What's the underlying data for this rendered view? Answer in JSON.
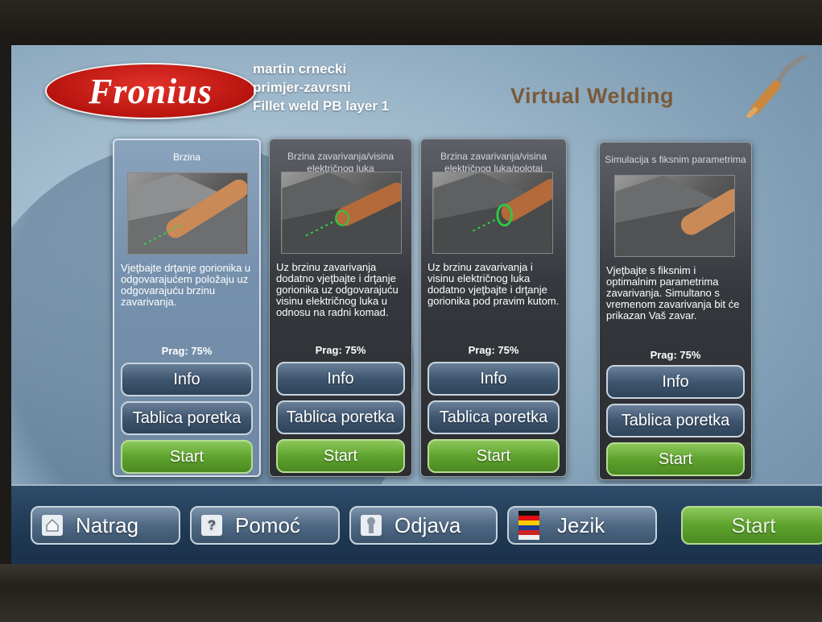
{
  "header": {
    "brand": "Fronius",
    "user_lines": [
      "martin crnecki",
      "primjer-zavrsni",
      "Fillet weld PB layer 1"
    ],
    "app_title": "Virtual Welding"
  },
  "cards": [
    {
      "title": "Brzina",
      "description": "Vjeţbajte drţanje gorionika u odgovarajućem položaju uz odgovarajuću brzinu zavarivanja.",
      "threshold": "Prag: 75%",
      "info_label": "Info",
      "table_label": "Tablica poretka",
      "start_label": "Start",
      "selected": true
    },
    {
      "title": "Brzina zavarivanja/visina električnog luka",
      "description": "Uz brzinu zavarivanja dodatno vjeţbajte i drţanje gorionika uz odgovarajuću visinu električnog luka u odnosu na radni komad.",
      "threshold": "Prag: 75%",
      "info_label": "Info",
      "table_label": "Tablica poretka",
      "start_label": "Start",
      "selected": false
    },
    {
      "title": "Brzina zavarivanja/visina električnog luka/poloţaj",
      "description": "Uz brzinu zavarivanja i visinu električnog luka dodatno vjeţbajte i drţanje gorionika pod pravim kutom.",
      "threshold": "Prag: 75%",
      "info_label": "Info",
      "table_label": "Tablica poretka",
      "start_label": "Start",
      "selected": false
    },
    {
      "title": "Simulacija s fiksnim parametrima",
      "description": "Vjeţbajte s fiksnim i optimalnim parametrima zavarivanja. Simultano s vremenom zavarivanja bit će prikazan Vaš zavar.",
      "threshold": "Prag: 75%",
      "info_label": "Info",
      "table_label": "Tablica poretka",
      "start_label": "Start",
      "selected": false
    }
  ],
  "footer": {
    "back_label": "Natrag",
    "back_icon": "home-icon",
    "help_label": "Pomoć",
    "help_icon": "question-icon",
    "help_glyph": "?",
    "logout_label": "Odjava",
    "logout_icon": "keyhole-icon",
    "language_label": "Jezik",
    "language_icon": "flags-icon",
    "start_label": "Start"
  },
  "colors": {
    "accent_green": "#5ea32e",
    "brand_red": "#c8170f",
    "title_brown": "#7a5a3a"
  }
}
